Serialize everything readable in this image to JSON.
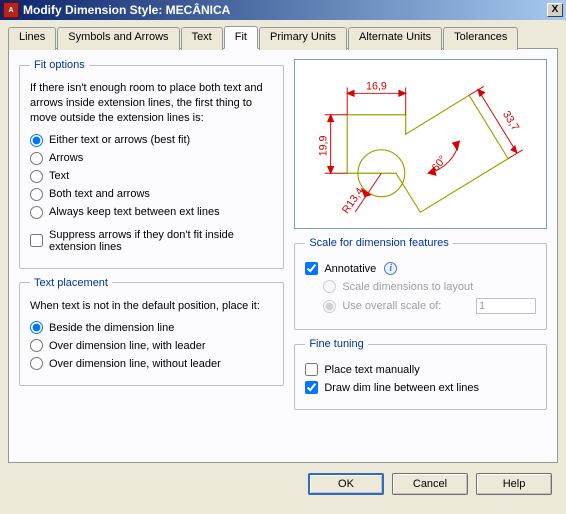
{
  "window": {
    "app_icon_text": "A",
    "title": "Modify Dimension Style: MECÂNICA",
    "close_glyph": "X"
  },
  "tabs": {
    "lines": "Lines",
    "symbols": "Symbols and Arrows",
    "text": "Text",
    "fit": "Fit",
    "primary": "Primary Units",
    "alternate": "Alternate Units",
    "tolerances": "Tolerances",
    "active": "fit"
  },
  "fit_options": {
    "legend": "Fit options",
    "description": "If there isn't enough room to place both text and arrows inside extension lines, the first thing to move outside the extension lines is:",
    "choices": {
      "either": "Either text or arrows (best fit)",
      "arrows": "Arrows",
      "text": "Text",
      "both": "Both text and arrows",
      "always": "Always keep text between ext lines"
    },
    "selected": "either",
    "suppress_label": "Suppress arrows if they don't fit inside extension lines",
    "suppress_checked": false
  },
  "text_placement": {
    "legend": "Text placement",
    "description": "When text is not in the default position, place it:",
    "choices": {
      "beside": "Beside the dimension line",
      "over_leader": "Over dimension line, with leader",
      "over_no_leader": "Over dimension line, without leader"
    },
    "selected": "beside"
  },
  "scale": {
    "legend": "Scale for dimension features",
    "annotative_label": "Annotative",
    "annotative_checked": true,
    "scale_to_layout": "Scale dimensions to layout",
    "use_overall": "Use overall scale of:",
    "overall_value": "1",
    "group_selected": "use_overall"
  },
  "fine_tuning": {
    "legend": "Fine tuning",
    "place_manually": "Place text manually",
    "place_manually_checked": false,
    "draw_dim_line": "Draw dim line between ext lines",
    "draw_dim_line_checked": true
  },
  "preview": {
    "dim_top": "16,9",
    "dim_left": "19,9",
    "dim_diag": "33,7",
    "radius": "R13,4",
    "angle": "60°"
  },
  "buttons": {
    "ok": "OK",
    "cancel": "Cancel",
    "help": "Help"
  }
}
